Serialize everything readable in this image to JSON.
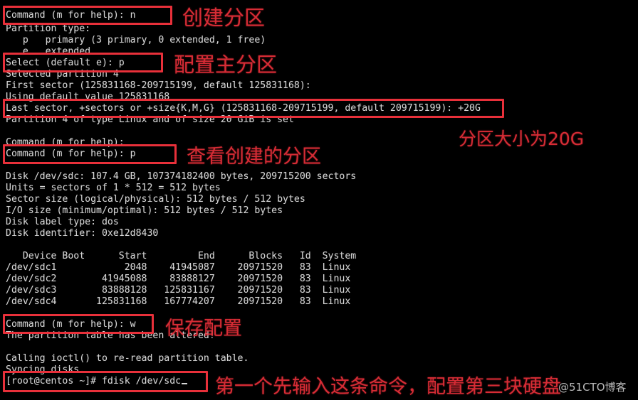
{
  "terminal": {
    "background_color": "#000000",
    "text_color": "#d6d6d6",
    "lines": [
      {
        "id": "l01",
        "text": "Command (m for help): n"
      },
      {
        "id": "l02",
        "text": "Partition type:"
      },
      {
        "id": "l03",
        "text": "   p   primary (3 primary, 0 extended, 1 free)"
      },
      {
        "id": "l04",
        "text": "   e   extended"
      },
      {
        "id": "l05",
        "text": "Select (default e): p"
      },
      {
        "id": "l06",
        "text": "Selected partition 4"
      },
      {
        "id": "l07",
        "text": "First sector (125831168-209715199, default 125831168):"
      },
      {
        "id": "l08",
        "text": "Using default value 125831168"
      },
      {
        "id": "l09",
        "text": "Last sector, +sectors or +size{K,M,G} (125831168-209715199, default 209715199): +20G"
      },
      {
        "id": "l10",
        "text": "Partition 4 of type Linux and of size 20 GiB is set"
      },
      {
        "id": "l11",
        "text": ""
      },
      {
        "id": "l12",
        "text": "Command (m for help):"
      },
      {
        "id": "l13",
        "text": "Command (m for help): p"
      },
      {
        "id": "l14",
        "text": ""
      },
      {
        "id": "l15",
        "text": "Disk /dev/sdc: 107.4 GB, 107374182400 bytes, 209715200 sectors"
      },
      {
        "id": "l16",
        "text": "Units = sectors of 1 * 512 = 512 bytes"
      },
      {
        "id": "l17",
        "text": "Sector size (logical/physical): 512 bytes / 512 bytes"
      },
      {
        "id": "l18",
        "text": "I/O size (minimum/optimal): 512 bytes / 512 bytes"
      },
      {
        "id": "l19",
        "text": "Disk label type: dos"
      },
      {
        "id": "l20",
        "text": "Disk identifier: 0xe12d8430"
      },
      {
        "id": "l21",
        "text": ""
      },
      {
        "id": "l22",
        "text": "   Device Boot      Start         End      Blocks   Id  System"
      },
      {
        "id": "l23",
        "text": "/dev/sdc1            2048    41945087    20971520   83  Linux"
      },
      {
        "id": "l24",
        "text": "/dev/sdc2        41945088    83888127    20971520   83  Linux"
      },
      {
        "id": "l25",
        "text": "/dev/sdc3        83888128   125831167    20971520   83  Linux"
      },
      {
        "id": "l26",
        "text": "/dev/sdc4       125831168   167774207    20971520   83  Linux"
      },
      {
        "id": "l27",
        "text": ""
      },
      {
        "id": "l28",
        "text": "Command (m for help): w"
      },
      {
        "id": "l29",
        "text": "The partition table has been altered!"
      },
      {
        "id": "l30",
        "text": ""
      },
      {
        "id": "l31",
        "text": "Calling ioctl() to re-read partition table."
      },
      {
        "id": "l32",
        "text": "Syncing disks."
      },
      {
        "id": "l33",
        "text": "[root@centos ~]# fdisk /dev/sdc"
      }
    ],
    "partition_table": {
      "headers": [
        "Device Boot",
        "Start",
        "End",
        "Blocks",
        "Id",
        "System"
      ],
      "rows": [
        [
          "/dev/sdc1",
          "2048",
          "41945087",
          "20971520",
          "83",
          "Linux"
        ],
        [
          "/dev/sdc2",
          "41945088",
          "83888127",
          "20971520",
          "83",
          "Linux"
        ],
        [
          "/dev/sdc3",
          "83888128",
          "125831167",
          "20971520",
          "83",
          "Linux"
        ],
        [
          "/dev/sdc4",
          "125831168",
          "167774207",
          "20971520",
          "83",
          "Linux"
        ]
      ]
    },
    "prompt": "[root@centos ~]#",
    "current_command": "fdisk /dev/sdc"
  },
  "annotations": {
    "color": "#e8303a",
    "notes": [
      {
        "id": "n1",
        "text": "创建分区"
      },
      {
        "id": "n2",
        "text": "配置主分区"
      },
      {
        "id": "n3",
        "text": "分区大小为20G"
      },
      {
        "id": "n4",
        "text": "查看创建的分区"
      },
      {
        "id": "n5",
        "text": "保存配置"
      },
      {
        "id": "n6",
        "text": "第一个先输入这条命令，配置第三块硬盘"
      }
    ],
    "highlight_boxes": [
      {
        "id": "b1",
        "target": "Command (m for help): n"
      },
      {
        "id": "b2",
        "target": "Select (default e): p"
      },
      {
        "id": "b3",
        "target": "Last sector, +sectors or +size{K,M,G} (125831168-209715199, default 209715199): +20G"
      },
      {
        "id": "b4",
        "target": "Command (m for help): p"
      },
      {
        "id": "b5",
        "target": "Command (m for help): w"
      },
      {
        "id": "b6",
        "target": "[root@centos ~]# fdisk /dev/sdc"
      }
    ]
  },
  "watermark": {
    "text": "@51CTO博客"
  }
}
